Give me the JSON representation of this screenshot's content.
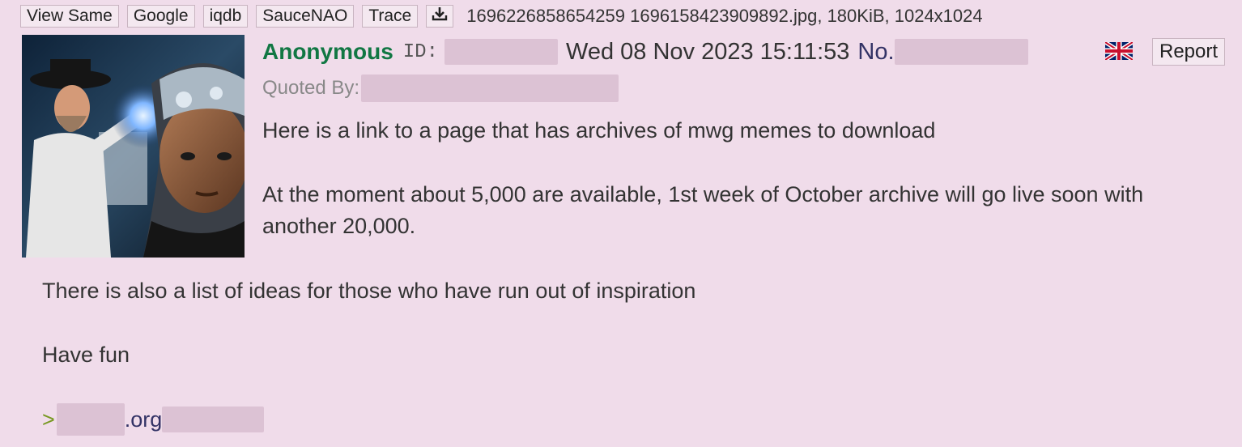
{
  "file_bar": {
    "buttons": [
      "View Same",
      "Google",
      "iqdb",
      "SauceNAO",
      "Trace"
    ],
    "download_icon": "download-icon",
    "file_info": "1696226858654259 1696158423909892.jpg, 180KiB, 1024x1024"
  },
  "post": {
    "name": "Anonymous",
    "id_label": "ID:",
    "date": "Wed 08 Nov 2023 15:11:53",
    "no_label": "No.",
    "flag_icon": "uk-flag-icon",
    "report_label": "Report",
    "quoted_by_label": "Quoted By:",
    "body": [
      "Here is a link to a page that has archives of mwg memes to download",
      "At the moment about 5,000 are available, 1st week of October archive will go live soon with",
      "another 20,000.",
      "There is also a list of ideas for those who have run out of inspiration",
      "Have fun"
    ],
    "greentext_marker": ">",
    "link_suffix": ".org"
  },
  "colors": {
    "background": "#f0dcea",
    "name": "#117743",
    "postno": "#333366",
    "greentext": "#789922",
    "redaction": "#dcc2d4"
  }
}
